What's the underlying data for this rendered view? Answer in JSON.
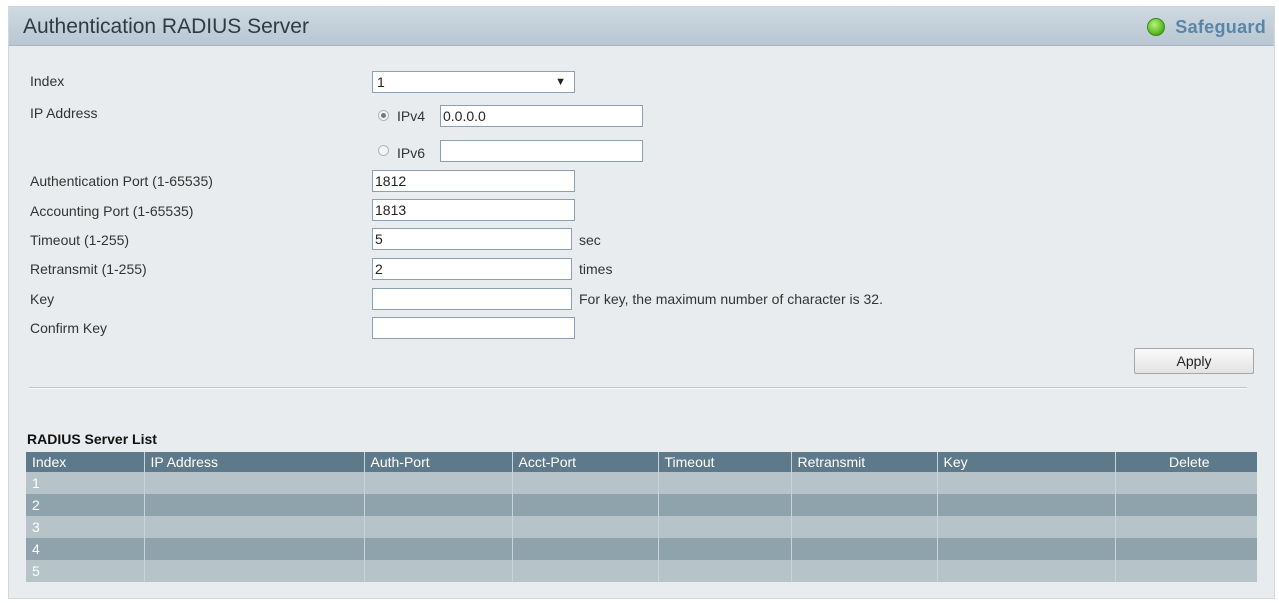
{
  "header": {
    "title": "Authentication RADIUS Server",
    "safeguard_label": "Safeguard",
    "safeguard_color": "#4fb31d"
  },
  "form": {
    "index_label": "Index",
    "index_value": "1",
    "ip_label": "IP Address",
    "ipv4_label": "IPv4",
    "ipv4_value": "0.0.0.0",
    "ipv6_label": "IPv6",
    "ipv6_value": "",
    "ip_selected": "IPv4",
    "auth_port_label": "Authentication Port (1-65535)",
    "auth_port_value": "1812",
    "acct_port_label": "Accounting Port (1-65535)",
    "acct_port_value": "1813",
    "timeout_label": "Timeout (1-255)",
    "timeout_value": "5",
    "timeout_unit": "sec",
    "retransmit_label": "Retransmit (1-255)",
    "retransmit_value": "2",
    "retransmit_unit": "times",
    "key_label": "Key",
    "key_value": "",
    "key_note": "For key, the maximum number of character is 32.",
    "confirm_key_label": "Confirm Key",
    "confirm_key_value": "",
    "apply_label": "Apply"
  },
  "server_list": {
    "title": "RADIUS Server List",
    "columns": [
      "Index",
      "IP Address",
      "Auth-Port",
      "Acct-Port",
      "Timeout",
      "Retransmit",
      "Key",
      "Delete"
    ],
    "rows": [
      [
        "1",
        "",
        "",
        "",
        "",
        "",
        "",
        ""
      ],
      [
        "2",
        "",
        "",
        "",
        "",
        "",
        "",
        ""
      ],
      [
        "3",
        "",
        "",
        "",
        "",
        "",
        "",
        ""
      ],
      [
        "4",
        "",
        "",
        "",
        "",
        "",
        "",
        ""
      ],
      [
        "5",
        "",
        "",
        "",
        "",
        "",
        "",
        ""
      ]
    ]
  }
}
